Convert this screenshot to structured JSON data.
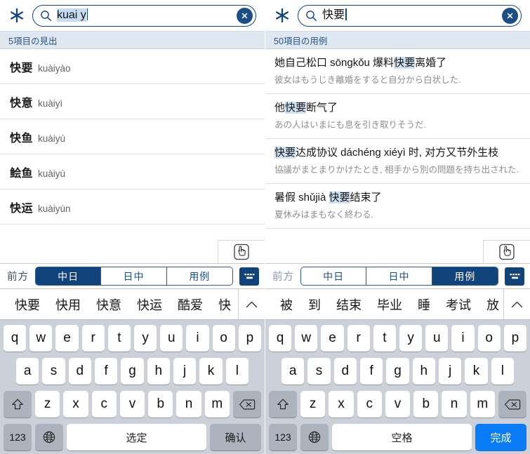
{
  "left_panel": {
    "app_icon": "asterisk-icon",
    "search": {
      "icon": "search-icon",
      "value": "kuai y",
      "placeholder": "",
      "clear_icon": "close-circle-icon"
    },
    "count_label": "5項目の見出",
    "entries": [
      {
        "hanzi": "快要",
        "pinyin": "kuàiyào"
      },
      {
        "hanzi": "快意",
        "pinyin": "kuàiyì"
      },
      {
        "hanzi": "快鱼",
        "pinyin": "kuàiyú"
      },
      {
        "hanzi": "鲙鱼",
        "pinyin": "kuàiyú"
      },
      {
        "hanzi": "快运",
        "pinyin": "kuàiyùn"
      }
    ],
    "hand_icon": "pointing-hand-icon",
    "toolbar": {
      "mode_label": "前方",
      "segments": [
        {
          "label": "中日",
          "active": true
        },
        {
          "label": "日中",
          "active": false
        },
        {
          "label": "用例",
          "active": false
        }
      ],
      "keyboard_icon": "keyboard-icon"
    },
    "candidates": [
      "快要",
      "快用",
      "快意",
      "快运",
      "酷爱",
      "快"
    ],
    "candidate_expand_icon": "chevron-up-icon",
    "keyboard": {
      "row1": [
        "q",
        "w",
        "e",
        "r",
        "t",
        "y",
        "u",
        "i",
        "o",
        "p"
      ],
      "row2": [
        "a",
        "s",
        "d",
        "f",
        "g",
        "h",
        "j",
        "k",
        "l"
      ],
      "row3": [
        "z",
        "x",
        "c",
        "v",
        "b",
        "n",
        "m"
      ],
      "shift_icon": "shift-arrow-icon",
      "backspace_icon": "backspace-icon",
      "numeric_label": "123",
      "globe_icon": "globe-icon",
      "space_label": "选定",
      "action_label": "确认",
      "action_primary": false
    }
  },
  "right_panel": {
    "app_icon": "asterisk-icon",
    "search": {
      "icon": "search-icon",
      "value": "快要",
      "placeholder": "",
      "clear_icon": "close-circle-icon"
    },
    "count_label": "50項目の用例",
    "examples": [
      {
        "cn_parts": [
          {
            "text": "她自己松口 sōngkǒu 爆料",
            "highlight": false
          },
          {
            "text": "快要",
            "highlight": true
          },
          {
            "text": "离婚了",
            "highlight": false
          }
        ],
        "jp": "彼女はもうじき離婚をすると自分から白状した."
      },
      {
        "cn_parts": [
          {
            "text": "他",
            "highlight": false
          },
          {
            "text": "快要",
            "highlight": true
          },
          {
            "text": "断气了",
            "highlight": false
          }
        ],
        "jp": "あの人はいまにも息を引き取りそうだ."
      },
      {
        "cn_parts": [
          {
            "text": "快要",
            "highlight": true
          },
          {
            "text": "达成协议 dáchéng xiéyì 时, 对方又节外生枝",
            "highlight": false
          }
        ],
        "jp": "協議がまとまりかけたとき, 相手から別の問題を持ち出された."
      },
      {
        "cn_parts": [
          {
            "text": "暑假 shǔjià ",
            "highlight": false
          },
          {
            "text": "快要",
            "highlight": true
          },
          {
            "text": "结束了",
            "highlight": false
          }
        ],
        "jp": "夏休みはまもなく終わる."
      }
    ],
    "hand_icon": "pointing-hand-icon",
    "toolbar": {
      "mode_label": "前方",
      "segments": [
        {
          "label": "中日",
          "active": false
        },
        {
          "label": "日中",
          "active": false
        },
        {
          "label": "用例",
          "active": true
        }
      ],
      "keyboard_icon": "keyboard-icon"
    },
    "candidates": [
      "被",
      "到",
      "结束",
      "毕业",
      "睡",
      "考试",
      "放"
    ],
    "candidate_expand_icon": "chevron-up-icon",
    "keyboard": {
      "row1": [
        "q",
        "w",
        "e",
        "r",
        "t",
        "y",
        "u",
        "i",
        "o",
        "p"
      ],
      "row2": [
        "a",
        "s",
        "d",
        "f",
        "g",
        "h",
        "j",
        "k",
        "l"
      ],
      "row3": [
        "z",
        "x",
        "c",
        "v",
        "b",
        "n",
        "m"
      ],
      "shift_icon": "shift-arrow-icon",
      "backspace_icon": "backspace-icon",
      "numeric_label": "123",
      "globe_icon": "globe-icon",
      "space_label": "空格",
      "action_label": "完成",
      "action_primary": true
    }
  },
  "colors": {
    "navy": "#12447c",
    "accent_blue": "#0a7cf7",
    "strip_bg": "#dfe7f0",
    "highlight": "#cfe2f5",
    "keyboard_bg": "#ccd0d8"
  }
}
